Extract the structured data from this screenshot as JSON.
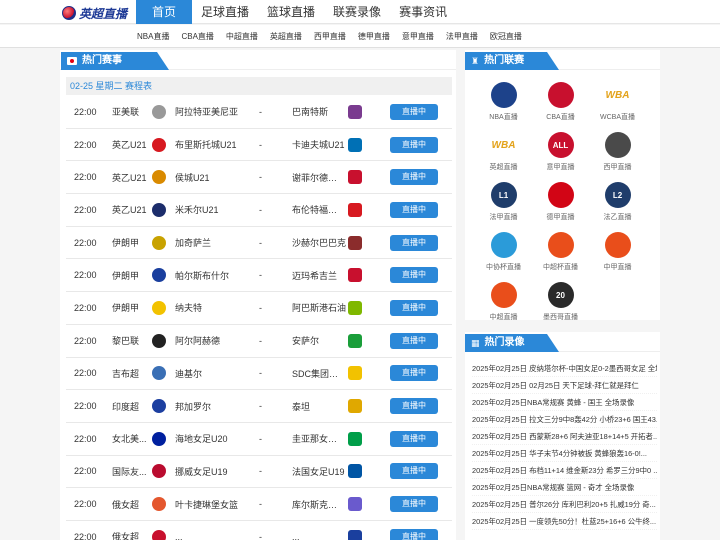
{
  "logo": {
    "text": "英超直播"
  },
  "nav": [
    "首页",
    "足球直播",
    "篮球直播",
    "联赛录像",
    "赛事资讯"
  ],
  "subnav": [
    "NBA直播",
    "CBA直播",
    "中超直播",
    "英超直播",
    "西甲直播",
    "德甲直播",
    "意甲直播",
    "法甲直播",
    "欧冠直播"
  ],
  "hot_matches": {
    "title": "热门赛事",
    "date": "02-25 星期二 赛程表",
    "vs": "-",
    "button": "直播中",
    "rows": [
      {
        "time": "22:00",
        "league": "亚美联",
        "home": "阿拉特亚美尼亚",
        "away": "巴南特斯",
        "hc": "#999",
        "ac": "#7a3b8f"
      },
      {
        "time": "22:00",
        "league": "英乙U21",
        "home": "布里斯托城U21",
        "away": "卡迪夫城U21",
        "hc": "#d71920",
        "ac": "#0070b5"
      },
      {
        "time": "22:00",
        "league": "英乙U21",
        "home": "侯城U21",
        "away": "谢菲尔德联队...",
        "hc": "#d98a00",
        "ac": "#c8102e"
      },
      {
        "time": "22:00",
        "league": "英乙U21",
        "home": "米禾尔U21",
        "away": "布伦特福德U21",
        "hc": "#1c2d6b",
        "ac": "#d71920"
      },
      {
        "time": "22:00",
        "league": "伊朗甲",
        "home": "加奇萨兰",
        "away": "沙赫尔巴巴克",
        "hc": "#c8a200",
        "ac": "#8b2c2c"
      },
      {
        "time": "22:00",
        "league": "伊朗甲",
        "home": "帕尔斯布什尔",
        "away": "迈玛希吉兰",
        "hc": "#1a3f9e",
        "ac": "#c8102e"
      },
      {
        "time": "22:00",
        "league": "伊朗甲",
        "home": "纳夫特",
        "away": "阿巴斯港石油",
        "hc": "#f2c200",
        "ac": "#7fb800"
      },
      {
        "time": "22:00",
        "league": "黎巴联",
        "home": "阿尔阿赫德",
        "away": "安萨尔",
        "hc": "#222",
        "ac": "#1a9e3a"
      },
      {
        "time": "22:00",
        "league": "吉布超",
        "home": "迪基尔",
        "away": "SDC集团医院",
        "hc": "#3a6fb5",
        "ac": "#f2c200"
      },
      {
        "time": "22:00",
        "league": "印度超",
        "home": "邦加罗尔",
        "away": "泰坦",
        "hc": "#1c3fa0",
        "ac": "#e0a800"
      },
      {
        "time": "22:00",
        "league": "女北美...",
        "home": "海地女足U20",
        "away": "圭亚那女足U20",
        "hc": "#00209f",
        "ac": "#009e49"
      },
      {
        "time": "22:00",
        "league": "国际友...",
        "home": "挪威女足U19",
        "away": "法国女足U19",
        "hc": "#ba0c2f",
        "ac": "#0055a4"
      },
      {
        "time": "22:00",
        "league": "俄女超",
        "home": "叶卡捷琳堡女篮",
        "away": "库尔斯克迪纳...",
        "hc": "#e4572e",
        "ac": "#6a5acd"
      },
      {
        "time": "22:00",
        "league": "俄女超",
        "home": "...",
        "away": "...",
        "hc": "#c8102e",
        "ac": "#1a3f9e"
      }
    ]
  },
  "hot_leagues": {
    "title": "热门联赛",
    "items": [
      {
        "name": "NBA直播",
        "icon": "nba-ball-icon",
        "color": "#1d428a",
        "glyph": ""
      },
      {
        "name": "CBA直播",
        "icon": "cba-ball-icon",
        "color": "#c8102e",
        "glyph": ""
      },
      {
        "name": "WCBA直播",
        "icon": "wcba-logo-icon",
        "color": "#ffffff",
        "glyph": "WBA"
      },
      {
        "name": "英超直播",
        "icon": "wcba-logo-icon",
        "color": "#ffffff",
        "glyph": "WBA"
      },
      {
        "name": "意甲直播",
        "icon": "allstar-icon",
        "color": "#c8102e",
        "glyph": "ALL"
      },
      {
        "name": "西甲直播",
        "icon": "player-silhouette-icon",
        "color": "#4a4a4a",
        "glyph": ""
      },
      {
        "name": "法甲直播",
        "icon": "ligue1-icon",
        "color": "#1f3d6b",
        "glyph": "L1"
      },
      {
        "name": "德甲直播",
        "icon": "bundesliga-icon",
        "color": "#d20515",
        "glyph": ""
      },
      {
        "name": "法乙直播",
        "icon": "ligue2-icon",
        "color": "#1f3d6b",
        "glyph": "L2"
      },
      {
        "name": "中协杯直播",
        "icon": "cup-icon",
        "color": "#2b9bd9",
        "glyph": ""
      },
      {
        "name": "中超杯直播",
        "icon": "csl-cup-icon",
        "color": "#e94e1b",
        "glyph": ""
      },
      {
        "name": "中甲直播",
        "icon": "china-league-icon",
        "color": "#e94e1b",
        "glyph": ""
      },
      {
        "name": "中超直播",
        "icon": "csl-icon",
        "color": "#e94e1b",
        "glyph": ""
      },
      {
        "name": "墨西哥直播",
        "icon": "liga-mx-icon",
        "color": "#2a2a2a",
        "glyph": "20"
      }
    ]
  },
  "hot_replays": {
    "title": "热门录像",
    "items": [
      "2025年02月25日 皮纳塔尔杯-中国女足0-2墨西哥女足 全场录像",
      "2025年02月25日 02月25日 天下足球-拜仁就是拜仁",
      "2025年02月25日NBA常规赛 黄蜂 - 国王 全场录像",
      "2025年02月25日 拉文三分9中8轰42分 小桥23+6 国王43...",
      "2025年02月25日 西蒙斯28+6 阿夫迪亚18+14+5 开拓者...",
      "2025年02月25日 华子末节4分钟被扳 黄蜂狼轰16-0!...",
      "2025年02月25日 布档11+14 维金斯23分 希罗三分9中0 ...",
      "2025年02月25日NBA常规赛 篮网 - 奇才 全场录像",
      "2025年02月25日 普尔26分 库利巴利20+5 扎威19分 奇...",
      "2025年02月25日 一度领先50分！杜蓝25+16+6 公牛终..."
    ]
  }
}
